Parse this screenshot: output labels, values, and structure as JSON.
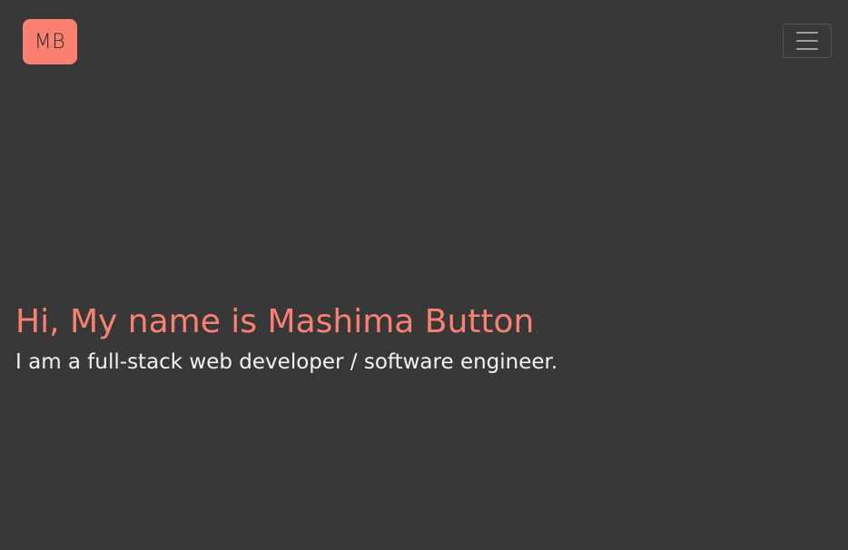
{
  "navbar": {
    "logo_text": "MB",
    "menu_icon": "hamburger-menu-icon"
  },
  "hero": {
    "title": "Hi, My name is Mashima Button",
    "subtitle": "I am a full-stack web developer / software engineer."
  },
  "colors": {
    "background": "#383838",
    "accent": "#fa8072",
    "text": "#f2f2f2"
  }
}
